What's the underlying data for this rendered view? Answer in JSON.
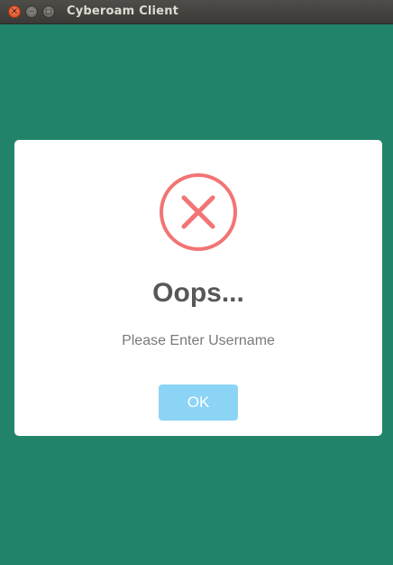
{
  "window": {
    "title": "Cyberoam Client",
    "controls": {
      "close_icon": "close-icon",
      "minimize_icon": "minimize-icon",
      "maximize_icon": "maximize-icon"
    }
  },
  "dialog": {
    "icon": "error-x-icon",
    "heading": "Oops...",
    "message": "Please Enter Username",
    "ok_label": "OK"
  },
  "colors": {
    "background": "#21846a",
    "error": "#f27474",
    "button": "#8cd4f5",
    "heading": "#575757",
    "message": "#797979"
  }
}
